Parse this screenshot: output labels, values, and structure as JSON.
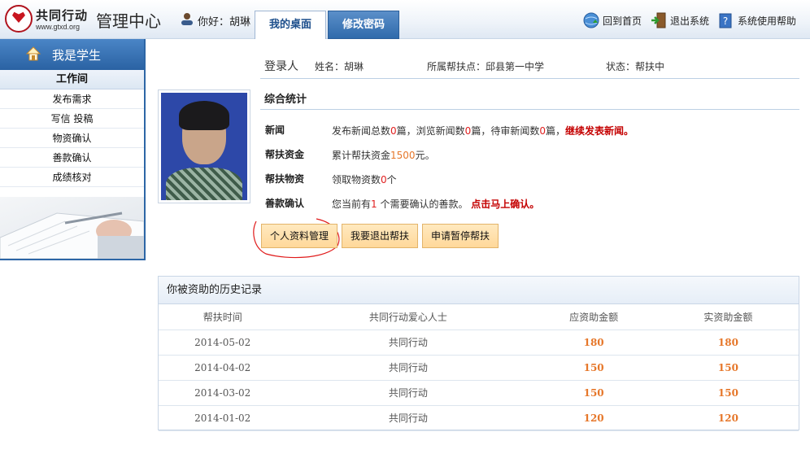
{
  "header": {
    "logo_cn": "共同行动",
    "logo_url": "www.gtxd.org",
    "app_title": "管理中心",
    "greeting": "你好：胡琳",
    "tabs": [
      {
        "label": "我的桌面",
        "active": true
      },
      {
        "label": "修改密码",
        "active": false
      }
    ],
    "links": [
      {
        "label": "回到首页",
        "icon": "home-globe-icon"
      },
      {
        "label": "退出系统",
        "icon": "logout-door-icon"
      },
      {
        "label": "系统使用帮助",
        "icon": "help-book-icon"
      }
    ]
  },
  "sidebar": {
    "title": "我是学生",
    "section": "工作间",
    "items": [
      "发布需求",
      "写信 投稿",
      "物资确认",
      "善款确认",
      "成绩核对"
    ]
  },
  "profile": {
    "login_label": "登录人",
    "name": "姓名：胡琳",
    "school": "所属帮扶点：邱县第一中学",
    "status": "状态：帮扶中"
  },
  "stats": {
    "title": "综合统计",
    "news_label": "新闻",
    "news_text": {
      "p1": "发布新闻总数",
      "published": "0",
      "p2": "篇，浏览新闻数",
      "viewed": "0",
      "p3": "篇，待审新闻数",
      "pending": "0",
      "p4": "篇，",
      "link": "继续发表新闻。"
    },
    "funds_label": "帮扶资金",
    "funds_text": {
      "p1": "累计帮扶资金",
      "amount": "1500",
      "p2": "元。"
    },
    "goods_label": "帮扶物资",
    "goods_text": {
      "p1": "领取物资数",
      "count": "0",
      "p2": "个"
    },
    "donation_label": "善款确认",
    "donation_text": {
      "p1": "您当前有",
      "count": "1",
      "p2": " 个需要确认的善款。 ",
      "link": "点击马上确认。"
    }
  },
  "buttons": {
    "profile": "个人资料管理",
    "quit": "我要退出帮扶",
    "pause": "申请暂停帮扶"
  },
  "history": {
    "title": "你被资助的历史记录",
    "columns": [
      "帮扶时间",
      "共同行动爱心人士",
      "应资助金额",
      "实资助金额"
    ],
    "rows": [
      [
        "2014-05-02",
        "共同行动",
        "180",
        "180"
      ],
      [
        "2014-04-02",
        "共同行动",
        "150",
        "150"
      ],
      [
        "2014-03-02",
        "共同行动",
        "150",
        "150"
      ],
      [
        "2014-01-02",
        "共同行动",
        "120",
        "120"
      ]
    ]
  }
}
